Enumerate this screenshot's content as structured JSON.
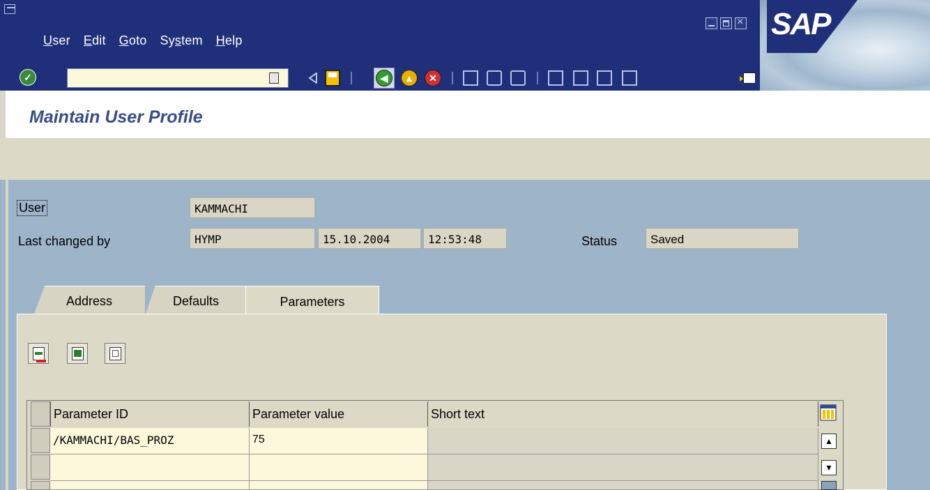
{
  "menu": {
    "items": [
      {
        "label_pre": "",
        "label_ul": "U",
        "label_post": "ser"
      },
      {
        "label_pre": "",
        "label_ul": "E",
        "label_post": "dit"
      },
      {
        "label_pre": "",
        "label_ul": "G",
        "label_post": "oto"
      },
      {
        "label_pre": "Sy",
        "label_ul": "s",
        "label_post": "tem"
      },
      {
        "label_pre": "",
        "label_ul": "H",
        "label_post": "elp"
      }
    ]
  },
  "brand": {
    "logo_text": "SAP",
    "color": "#1f2f7a"
  },
  "toolbar": {
    "command_value": "",
    "icons": [
      "enter-icon",
      "back-icon",
      "save-icon",
      "back-nav-icon",
      "exit-icon",
      "cancel-icon",
      "print-icon",
      "find-icon",
      "find-next-icon",
      "first-page-icon",
      "previous-page-icon",
      "next-page-icon",
      "last-page-icon",
      "layout-menu-icon"
    ]
  },
  "page": {
    "title": "Maintain User Profile"
  },
  "header": {
    "user_label": "User",
    "user_value": "KAMMACHI",
    "last_changed_label": "Last changed by",
    "last_changed_value": "HYMP",
    "date": "15.10.2004",
    "time": "12:53:48",
    "status_label": "Status",
    "status_value": "Saved"
  },
  "tabs": {
    "items": [
      {
        "label": "Address"
      },
      {
        "label": "Defaults"
      },
      {
        "label": "Parameters"
      }
    ],
    "active": "Parameters"
  },
  "params_table": {
    "columns": [
      "Parameter ID",
      "Parameter value",
      "Short text"
    ],
    "rows": [
      [
        "/KAMMACHI/BAS_PROZ",
        "75",
        ""
      ],
      [
        "",
        "",
        ""
      ],
      [
        "",
        "",
        ""
      ]
    ]
  }
}
